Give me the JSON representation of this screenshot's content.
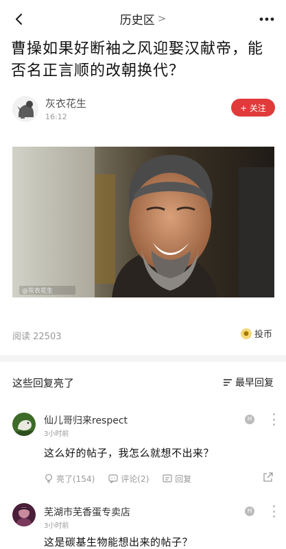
{
  "nav": {
    "title": "历史区",
    "chevron": ">",
    "back_icon": "chevron-left-icon",
    "more_icon": "ellipsis-icon"
  },
  "post": {
    "title": "曹操如果好断袖之风迎娶汉献帝，能否名正言顺的改朝换代？",
    "author_name": "灰衣花生",
    "time": "16:12",
    "follow_label": "+ 关注",
    "image_watermark": "@灰衣花生",
    "reads": "阅读 22503",
    "tip_label": "投币"
  },
  "section": {
    "title": "这些回复亮了",
    "sort_label": "最早回复"
  },
  "comments": [
    {
      "name": "仙儿哥归来respect",
      "time": "3小时前",
      "text": "这么好的帖子，我怎么就想不出来？",
      "badge": "H",
      "like_label": "亮了(154)",
      "comment_label": "评论(2)",
      "reply_label": "回复"
    },
    {
      "name": "芜湖市芜香蛋专卖店",
      "time": "3小时前",
      "text": "这是碳基生物能想出来的帖子？",
      "badge": "H"
    }
  ],
  "colors": {
    "accent": "#e13a3a",
    "muted": "#999999",
    "separator": "#f4f4f4"
  }
}
